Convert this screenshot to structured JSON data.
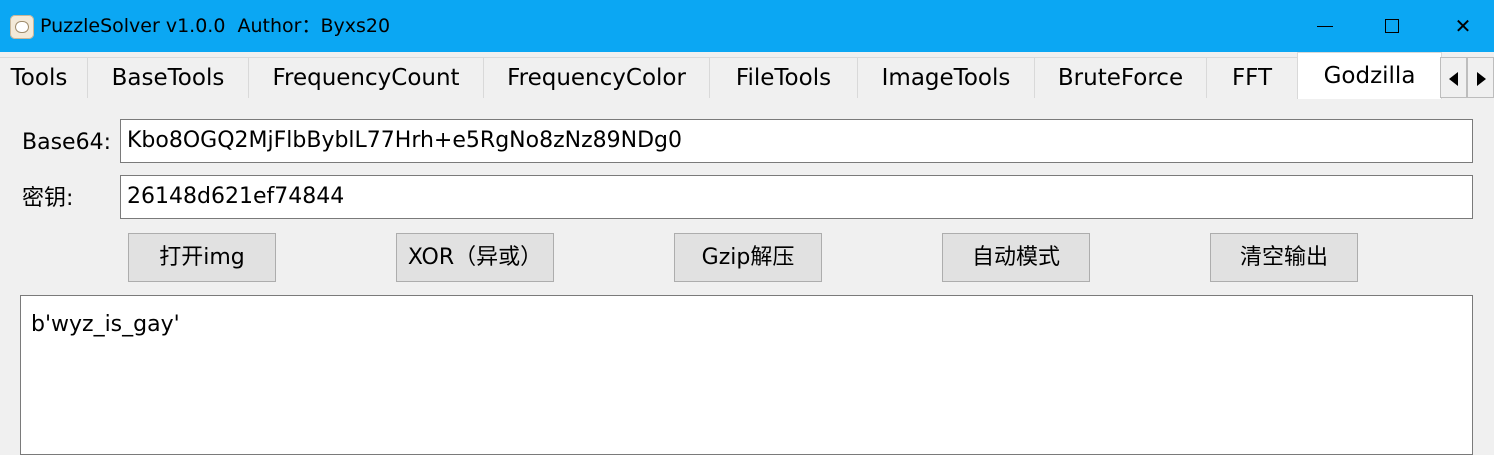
{
  "window": {
    "title": "PuzzleSolver v1.0.0  Author：Byxs20",
    "controls": {
      "minimize_icon": "minimize-icon",
      "maximize_icon": "maximize-icon",
      "close_icon": "close-icon",
      "close_glyph": "✕"
    }
  },
  "tabs": [
    {
      "label": "Tools",
      "active": false
    },
    {
      "label": "BaseTools",
      "active": false
    },
    {
      "label": "FrequencyCount",
      "active": false
    },
    {
      "label": "FrequencyColor",
      "active": false
    },
    {
      "label": "FileTools",
      "active": false
    },
    {
      "label": "ImageTools",
      "active": false
    },
    {
      "label": "BruteForce",
      "active": false
    },
    {
      "label": "FFT",
      "active": false
    },
    {
      "label": "Godzilla",
      "active": true
    }
  ],
  "form": {
    "base64_label": "Base64:",
    "base64_value": "Kbo8OGQ2MjFlbByblL77Hrh+e5RgNo8zNz89NDg0",
    "key_label": "密钥:",
    "key_value": "26148d621ef74844"
  },
  "buttons": {
    "open_img": "打开img",
    "xor": "XOR（异或）",
    "gzip": "Gzip解压",
    "auto": "自动模式",
    "clear": "清空输出"
  },
  "output": {
    "text": "b'wyz_is_gay'"
  },
  "colors": {
    "titlebar": "#0ba7f3",
    "background": "#f0f0f0",
    "button": "#e1e1e1"
  }
}
